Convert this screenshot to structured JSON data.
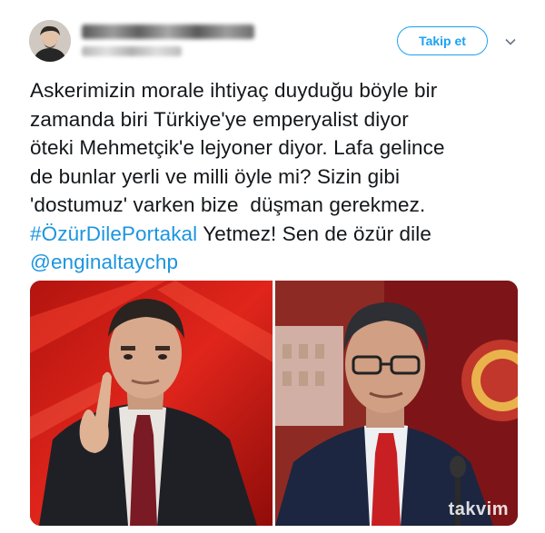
{
  "follow_button": {
    "label": "Takip et"
  },
  "tweet": {
    "lines": [
      {
        "text": "Askerimizin morale ihtiyaç duyduğu böyle bir"
      },
      {
        "text": "zamanda biri Türkiye'ye emperyalist diyor"
      },
      {
        "text": "öteki Mehmetçik'e lejyoner diyor. Lafa gelince"
      },
      {
        "text": "de bunlar yerli ve milli öyle mi? Sizin gibi"
      },
      {
        "text": "'dostumuz' varken bize  düşman gerekmez."
      }
    ],
    "hashtag": "#ÖzürDilePortakal",
    "after_hashtag": " Yetmez! Sen de özür dile",
    "mention": "@enginaltaychp"
  },
  "media": {
    "watermark": "takvim"
  },
  "colors": {
    "accent": "#1da1f2",
    "link": "#1b95e0",
    "text": "#14171a"
  },
  "icons": {
    "menu": "chevron-down-icon"
  }
}
